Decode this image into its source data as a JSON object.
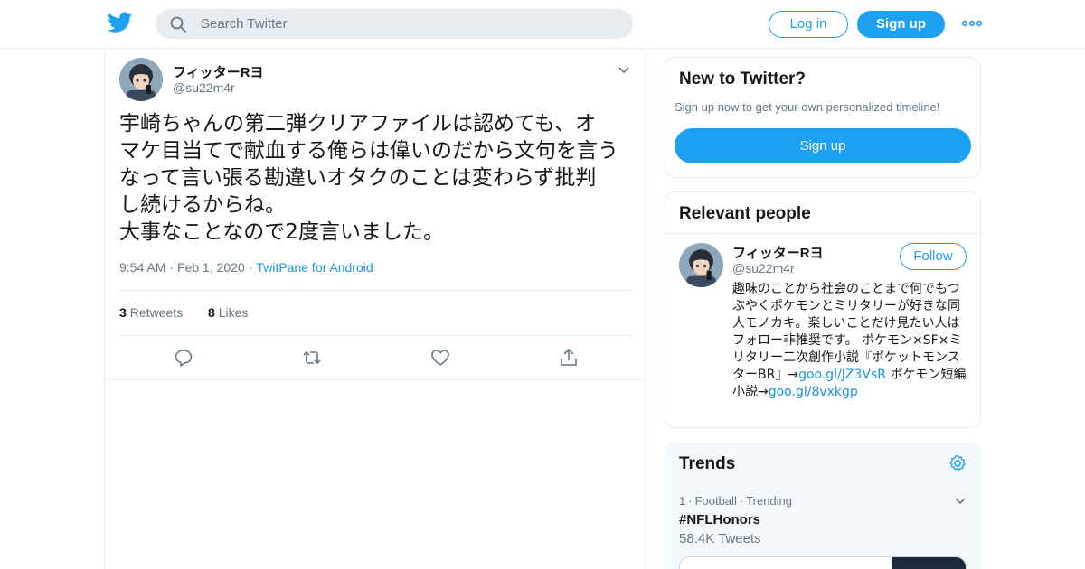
{
  "header": {
    "search_placeholder": "Search Twitter",
    "login_label": "Log in",
    "signup_label": "Sign up",
    "brand_color": "#1da1f2"
  },
  "tweet": {
    "author_name": "フィッターRヨ",
    "author_handle": "@su22m4r",
    "text": "宇崎ちゃんの第二弾クリアファイルは認めても、オ\nマケ目当てで献血する俺らは偉いのだから文句を言う\nなって言い張る勘違いオタクのことは変わらず批判\nし続けるからね。\n大事なことなので2度言いました。",
    "time": "9:54 AM",
    "date": "Feb 1, 2020",
    "source": "TwitPane for Android",
    "retweets_count": "3",
    "retweets_label": "Retweets",
    "likes_count": "8",
    "likes_label": "Likes"
  },
  "sidebar": {
    "new_to_twitter": {
      "title": "New to Twitter?",
      "subtitle": "Sign up now to get your own personalized timeline!",
      "button_label": "Sign up"
    },
    "relevant_people": {
      "title": "Relevant people",
      "name": "フィッターRヨ",
      "handle": "@su22m4r",
      "follow_label": "Follow",
      "bio_text": "趣味のことから社会のことまで何でもつぶやくポケモンとミリタリーが好きな同人モノカキ。楽しいことだけ見たい人はフォロー非推奨です。 ポケモン×SF×ミリタリー二次創作小説『ポケットモンスターBR』→",
      "bio_link1": "goo.gl/JZ3VsR",
      "bio_mid": " ポケモン短編小説→",
      "bio_link2": "goo.gl/8vxkgp"
    },
    "trends": {
      "title": "Trends",
      "items": [
        {
          "rank": "1",
          "category": "Football",
          "status": "Trending",
          "tag": "#NFLHonors",
          "count": "58.4K Tweets"
        }
      ]
    }
  }
}
